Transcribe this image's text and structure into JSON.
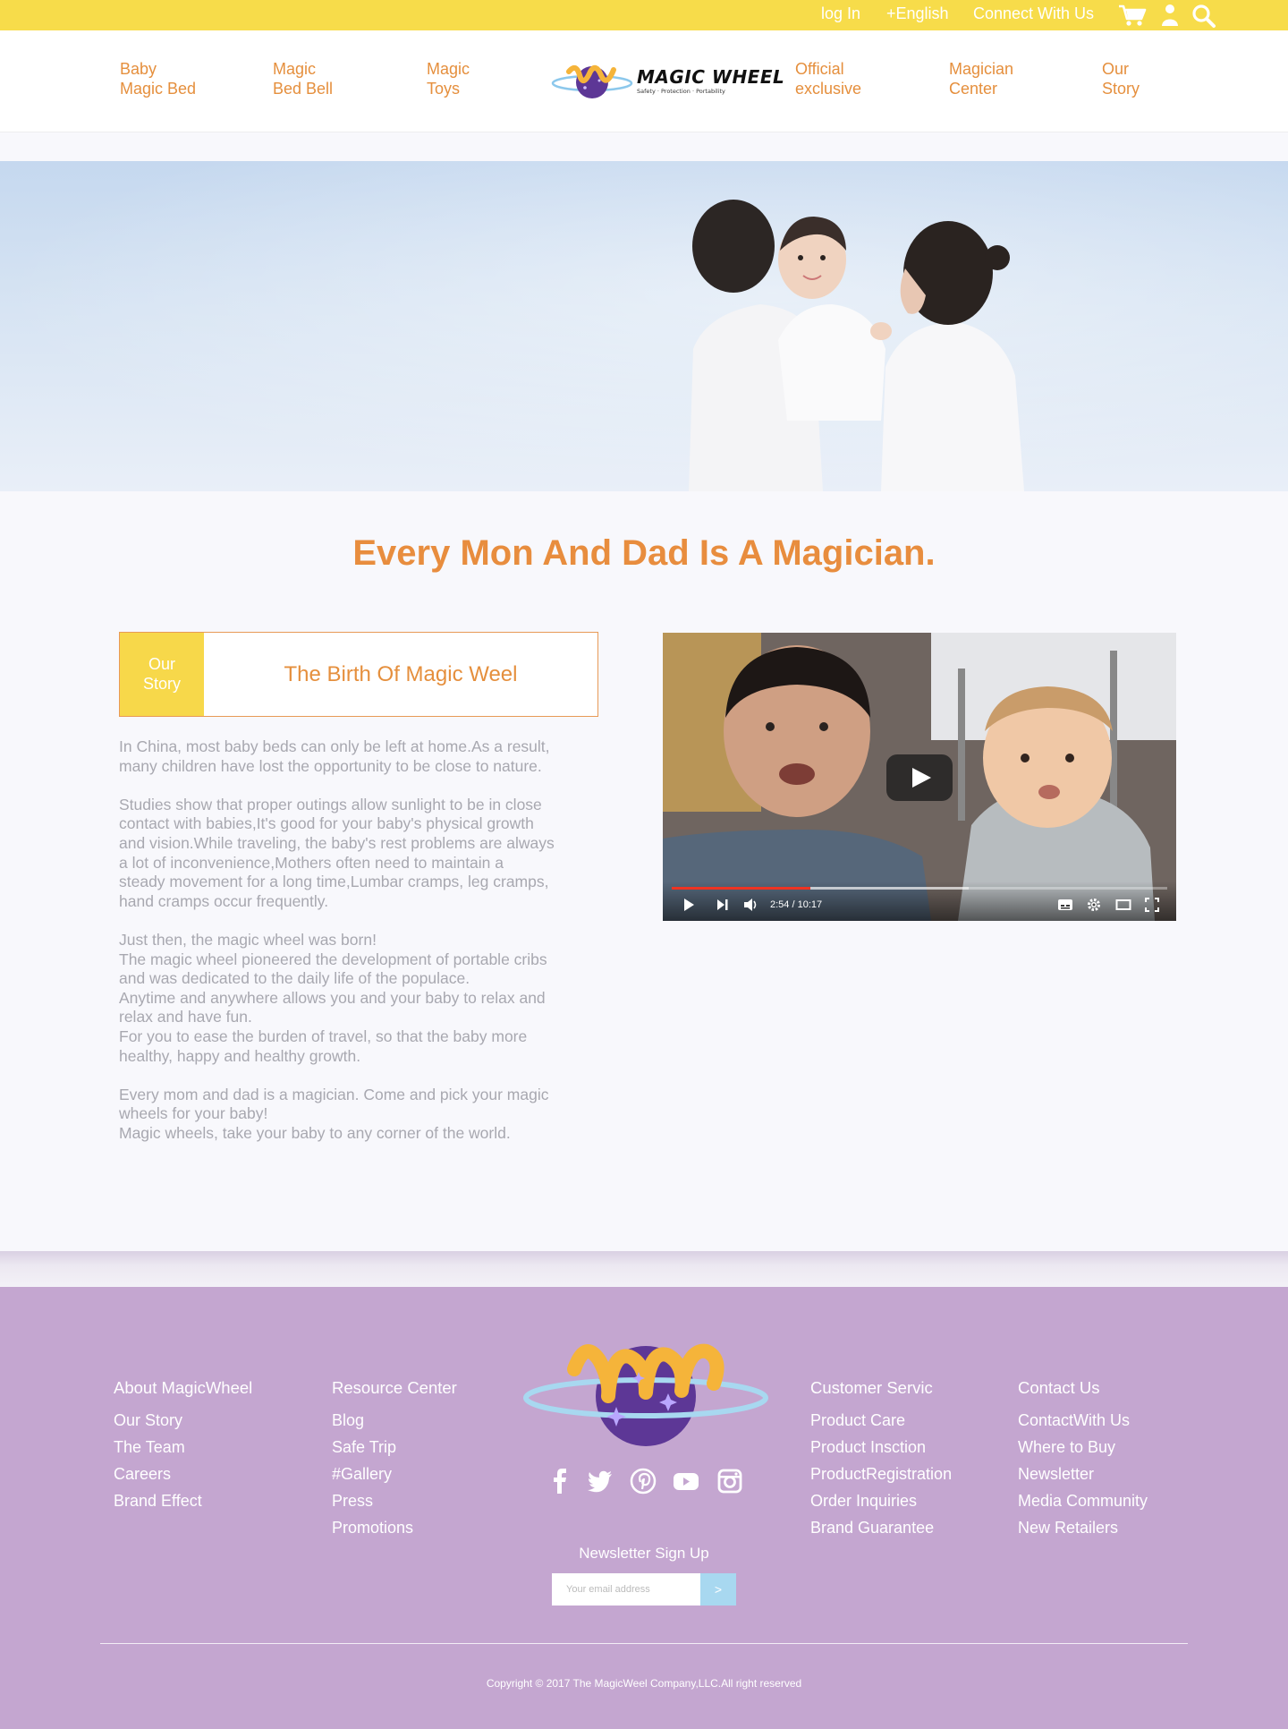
{
  "topbar": {
    "login": "log In",
    "language": "+English",
    "connect": "Connect With Us",
    "cart_icon": "cart-icon",
    "user_icon": "user-icon",
    "search_icon": "search-icon",
    "bg_color": "#f7dc4a"
  },
  "nav": {
    "items": [
      {
        "line1": "Baby",
        "line2": "Magic Bed"
      },
      {
        "line1": "Magic",
        "line2": "Bed Bell"
      },
      {
        "line1": "Magic",
        "line2": "Toys"
      },
      {
        "line1": "Official",
        "line2": "exclusive"
      },
      {
        "line1": "Magician",
        "line2": "Center"
      },
      {
        "line1": "Our",
        "line2": "Story"
      }
    ],
    "logo": {
      "wordmark": "MAGIC WHEEL",
      "tagline": "Safety · Protection · Portability"
    },
    "accent_color": "#e58f3d"
  },
  "headline": "Every Mon And Dad Is A Magician.",
  "story": {
    "tag_line1": "Our",
    "tag_line2": "Story",
    "title": "The Birth Of Magic Weel",
    "paragraphs": [
      "In China, most baby beds can only be left at home.As a result,\nmany children have lost the opportunity to be close to nature.",
      "Studies show that proper outings allow sunlight to be in close\ncontact with babies,It's good for your baby's physical growth\nand vision.While traveling, the baby's rest problems are always\na lot of inconvenience,Mothers often need to maintain a\nsteady movement for a long time,Lumbar cramps, leg cramps,\n hand cramps occur frequently.",
      "Just then, the magic wheel was born!\nThe magic wheel pioneered the development of portable cribs\n and was dedicated to the daily life of the populace.\nAnytime and anywhere allows you and your baby to relax and\nrelax and have fun.\nFor you to ease the burden of travel, so that the baby more\nhealthy, happy and healthy growth.",
      "Every mom and dad is a magician. Come and pick your magic\nwheels for your baby!\nMagic wheels, take your baby to any corner of the world."
    ]
  },
  "video": {
    "time": "2:54 / 10:17",
    "progress": 0.28,
    "buffered": 0.6,
    "icons": [
      "play-icon",
      "next-icon",
      "volume-icon",
      "subtitles-icon",
      "settings-icon",
      "theater-icon",
      "fullscreen-icon"
    ]
  },
  "footer": {
    "bg_color": "#c4a6d0",
    "columns": [
      {
        "heading": "About MagicWheel",
        "links": [
          "Our Story",
          "The Team",
          "Careers",
          "Brand Effect"
        ]
      },
      {
        "heading": "Resource Center",
        "links": [
          "Blog",
          "Safe Trip",
          "#Gallery",
          "Press",
          "Promotions"
        ]
      },
      {
        "heading": "Customer Servic",
        "links": [
          "Product Care",
          "Product Insction",
          "ProductRegistration",
          "Order Inquiries",
          "Brand Guarantee"
        ]
      },
      {
        "heading": "Contact Us",
        "links": [
          "ContactWith Us",
          "Where to Buy",
          "Newsletter",
          "Media Community",
          "New Retailers"
        ]
      }
    ],
    "socials": [
      "facebook-icon",
      "twitter-icon",
      "pinterest-icon",
      "youtube-icon",
      "instagram-icon"
    ],
    "newsletter": {
      "title": "Newsletter Sign Up",
      "placeholder": "Your email address",
      "button": ">"
    },
    "copyright": "Copyright © 2017 The MagicWeel Company,LLC.All right reserved"
  }
}
